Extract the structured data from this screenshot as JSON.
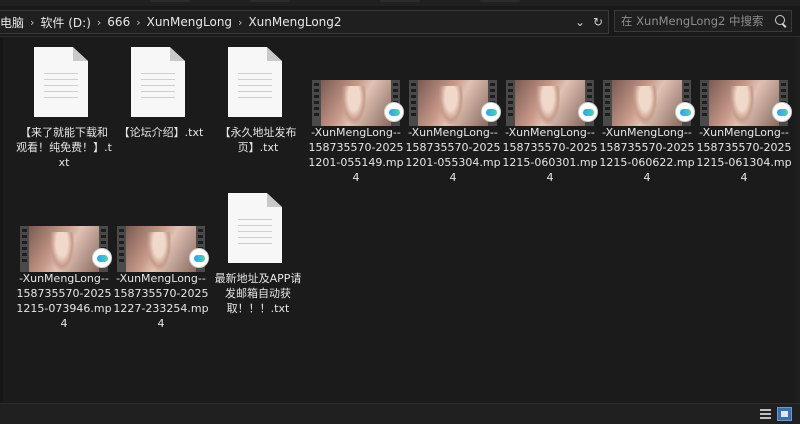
{
  "breadcrumb": {
    "items": [
      "电脑",
      "软件 (D:)",
      "666",
      "XunMengLong",
      "XunMengLong2"
    ],
    "separator": "›",
    "dropdown_icon": "chevron-down-icon",
    "refresh_icon": "refresh-icon"
  },
  "search": {
    "placeholder": "在 XunMengLong2 中搜索",
    "icon": "search-icon"
  },
  "files": [
    {
      "type": "txt",
      "name": "【来了就能下载和观看！纯免费！】.txt"
    },
    {
      "type": "txt",
      "name": "【论坛介绍】.txt"
    },
    {
      "type": "txt",
      "name": "【永久地址发布页】.txt"
    },
    {
      "type": "mp4",
      "name": "-XunMengLong--158735570-20251201-055149.mp4"
    },
    {
      "type": "mp4",
      "name": "-XunMengLong--158735570-20251201-055304.mp4"
    },
    {
      "type": "mp4",
      "name": "-XunMengLong--158735570-20251215-060301.mp4"
    },
    {
      "type": "mp4",
      "name": "-XunMengLong--158735570-20251215-060622.mp4"
    },
    {
      "type": "mp4",
      "name": "-XunMengLong--158735570-20251215-061304.mp4"
    },
    {
      "type": "mp4",
      "name": "-XunMengLong--158735570-20251215-073946.mp4"
    },
    {
      "type": "mp4",
      "name": "-XunMengLong--158735570-20251227-233254.mp4"
    },
    {
      "type": "txt",
      "name": "最新地址及APP请发邮箱自动获取！！！.txt"
    }
  ],
  "statusbar": {
    "view_details_icon": "details-view-icon",
    "view_thumbnails_icon": "large-icons-view-icon",
    "active_view": "large-icons"
  },
  "colors": {
    "background": "#1b1b1b",
    "text": "#e6e6e6",
    "accent": "#3d6fa8"
  }
}
